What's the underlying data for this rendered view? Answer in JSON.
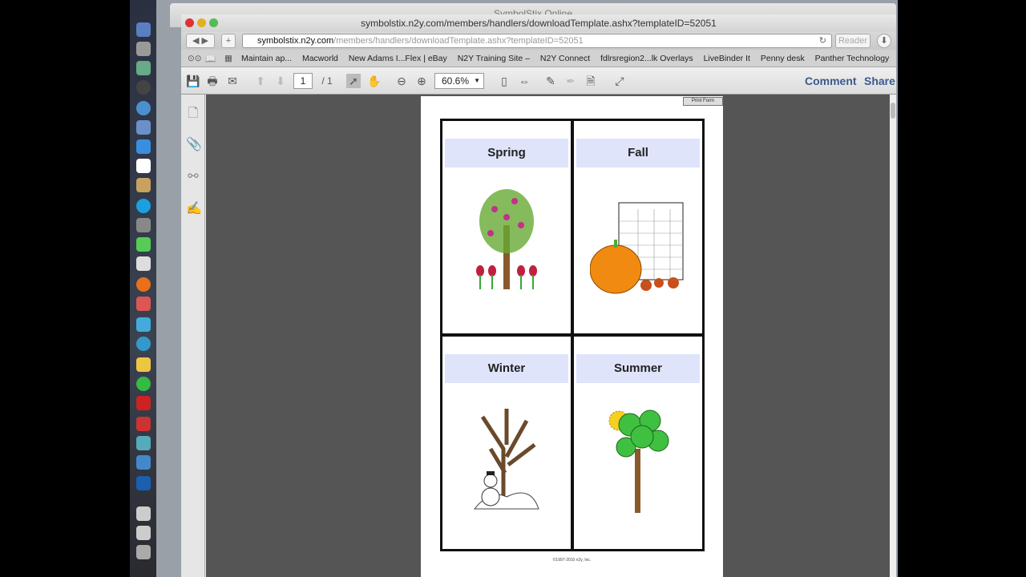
{
  "back_window": {
    "title": "SymbolStix Online"
  },
  "window": {
    "title": "symbolstix.n2y.com/members/handlers/downloadTemplate.ashx?templateID=52051"
  },
  "toolbar": {
    "url_host": "symbolstix.n2y.com",
    "url_path": "/members/handlers/downloadTemplate.ashx?templateID=52051",
    "reader_label": "Reader"
  },
  "bookmarks": [
    "Maintain ap...",
    "Macworld",
    "New Adams I...Flex | eBay",
    "N2Y Training Site –",
    "N2Y Connect",
    "fdlrsregion2...lk Overlays",
    "LiveBinder It",
    "Penny desk",
    "Panther Technology"
  ],
  "pdf_toolbar": {
    "page": "1",
    "page_total": "/ 1",
    "zoom": "60.6%",
    "comment": "Comment",
    "share": "Share"
  },
  "document": {
    "print_form": "Print Form",
    "cards": [
      {
        "label": "Spring"
      },
      {
        "label": "Fall"
      },
      {
        "label": "Winter"
      },
      {
        "label": "Summer"
      }
    ],
    "copyright": "©1997-2010 n2y, Inc."
  },
  "colors": {
    "label_bg": "#dfe4fb",
    "link": "#3a5a8c"
  }
}
